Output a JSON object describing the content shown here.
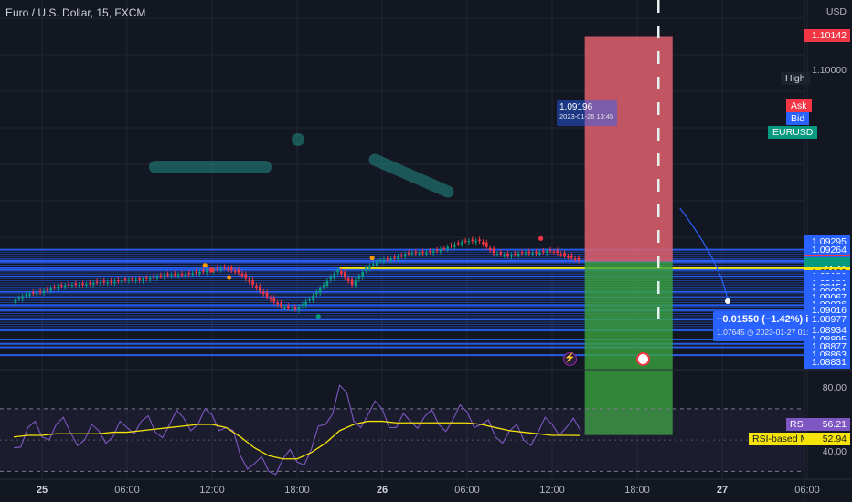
{
  "header": {
    "title": "Euro / U.S. Dollar, 15, FXCM"
  },
  "axis": {
    "currency": "USD"
  },
  "price_labels": [
    {
      "name": "price-label-stop",
      "text": "1.10142",
      "style": "red",
      "y": 1.10142
    },
    {
      "name": "price-tick-1-10000",
      "text": "1.10000",
      "style": "tick",
      "y": 1.1
    },
    {
      "name": "price-label-high",
      "text": "1.09295",
      "style": "blue",
      "y": 1.09295
    },
    {
      "name": "price-label-1-09264",
      "text": "1.09264",
      "style": "blue",
      "y": 1.09264
    },
    {
      "name": "price-label-ask",
      "text": "1.09219",
      "style": "red",
      "y": 1.09219
    },
    {
      "name": "price-label-bid",
      "text": "1.09215",
      "style": "blue",
      "y": 1.09215
    },
    {
      "name": "price-label-last",
      "text": "1.09215",
      "style": "green",
      "y": 1.09205
    },
    {
      "name": "price-label-change",
      "text": "+0.55%",
      "style": "green",
      "y": 1.09195
    },
    {
      "name": "price-label-countdown",
      "text": "11:11",
      "style": "green",
      "y": 1.09185
    },
    {
      "name": "price-label-yellow-level",
      "text": "1.09189",
      "style": "yellow",
      "y": 1.0917
    },
    {
      "name": "price-label-1-09181-a",
      "text": "1.09181",
      "style": "blue",
      "y": 1.09155
    },
    {
      "name": "price-label-1-09181-b",
      "text": "1.09181",
      "style": "blue",
      "y": 1.0914
    },
    {
      "name": "price-label-1-09181-c",
      "text": "1.09181",
      "style": "blue",
      "y": 1.09125
    },
    {
      "name": "price-label-1-09154",
      "text": "1.09154",
      "style": "blue",
      "y": 1.0911
    },
    {
      "name": "price-label-1-09091",
      "text": "1.09091",
      "style": "blue",
      "y": 1.0909
    },
    {
      "name": "price-label-1-09067",
      "text": "1.09067",
      "style": "blue",
      "y": 1.09067
    },
    {
      "name": "price-label-1-09036",
      "text": "1.09036",
      "style": "blue",
      "y": 1.09036
    },
    {
      "name": "price-label-1-09016",
      "text": "1.09016",
      "style": "blue",
      "y": 1.09016
    },
    {
      "name": "price-label-1-08977",
      "text": "1.08977",
      "style": "blue",
      "y": 1.08977
    },
    {
      "name": "price-label-1-08934",
      "text": "1.08934",
      "style": "blue",
      "y": 1.08934
    },
    {
      "name": "price-label-1-08895",
      "text": "1.08895",
      "style": "blue",
      "y": 1.08895
    },
    {
      "name": "price-label-1-08877",
      "text": "1.08877",
      "style": "blue",
      "y": 1.08865
    },
    {
      "name": "price-label-1-08863",
      "text": "1.08863",
      "style": "blue",
      "y": 1.0883
    },
    {
      "name": "price-label-1-08831",
      "text": "1.08831",
      "style": "blue",
      "y": 1.088
    }
  ],
  "side_tags": {
    "high": "High",
    "ask": "Ask",
    "bid": "Bid",
    "symbol": "EURUSD"
  },
  "tooltip": {
    "price": "1.09196",
    "date": "2023-01-26 13:45"
  },
  "measure": {
    "change": "−0.01550 (−1.42%) in",
    "target": "1.07645 ◷ 2023-01-27 01:"
  },
  "rsi_panel": {
    "ticks": [
      "80.00",
      "40.00"
    ],
    "rsi_label": "RSI",
    "rsi_value": "56.21",
    "ma_label": "RSI-based MA",
    "ma_value": "52.94"
  },
  "time_axis": [
    {
      "text": "25",
      "bold": true,
      "x": 0
    },
    {
      "text": "06:00",
      "bold": false,
      "x": 6
    },
    {
      "text": "12:00",
      "bold": false,
      "x": 12
    },
    {
      "text": "18:00",
      "bold": false,
      "x": 18
    },
    {
      "text": "26",
      "bold": true,
      "x": 24
    },
    {
      "text": "06:00",
      "bold": false,
      "x": 30
    },
    {
      "text": "12:00",
      "bold": false,
      "x": 36
    },
    {
      "text": "18:00",
      "bold": false,
      "x": 42
    },
    {
      "text": "27",
      "bold": true,
      "x": 48
    },
    {
      "text": "06:00",
      "bold": false,
      "x": 54
    }
  ],
  "colors": {
    "background": "#131722",
    "up": "#089981",
    "down": "#f23645",
    "level_line": "#2962ff",
    "yellow_level": "#f5e30a",
    "rsi_line": "#7e57c2",
    "rsi_ma": "#f5e30a",
    "stop_zone": "#e0626d",
    "target_zone": "#3ba33f"
  },
  "chart_data": {
    "type": "candlestick",
    "title": "Euro / U.S. Dollar, 15, FXCM",
    "xlabel": "",
    "ylabel": "USD",
    "x_unit": "hours from 2023-01-25 00:00",
    "ylim": [
      1.0879,
      1.1029
    ],
    "close_series": {
      "x": [
        -2,
        -1,
        0,
        1,
        2,
        3,
        4,
        5,
        6,
        7,
        8,
        9,
        10,
        11,
        12,
        13,
        14,
        15,
        16,
        17,
        18,
        19,
        20,
        21,
        22,
        23,
        24,
        25,
        26,
        27,
        28,
        29,
        30,
        31,
        32,
        33,
        34,
        35,
        36,
        37,
        38
      ],
      "y": [
        1.0905,
        1.0908,
        1.0909,
        1.0911,
        1.0912,
        1.0912,
        1.0913,
        1.0913,
        1.0914,
        1.0914,
        1.0915,
        1.0916,
        1.0916,
        1.0917,
        1.0918,
        1.0919,
        1.0917,
        1.0912,
        1.0907,
        1.0903,
        1.0902,
        1.0906,
        1.0912,
        1.0918,
        1.0912,
        1.0919,
        1.0922,
        1.0923,
        1.0925,
        1.0925,
        1.0926,
        1.0928,
        1.093,
        1.093,
        1.0925,
        1.0924,
        1.0925,
        1.0925,
        1.0926,
        1.0924,
        1.0922
      ]
    },
    "levels": [
      1.09264,
      1.09219,
      1.09215,
      1.09189,
      1.09181,
      1.09154,
      1.09091,
      1.09067,
      1.09036,
      1.09016,
      1.08977,
      1.08934,
      1.08895,
      1.08877,
      1.08863,
      1.08831
    ],
    "yellow_level": 1.09189,
    "position": {
      "type": "short",
      "entry": 1.09215,
      "stop": 1.10142,
      "target": 1.07645,
      "x_start": 38.3,
      "x_end": 44.5
    },
    "session_line_x": 43.5,
    "rsi": {
      "ylim": [
        25,
        95
      ],
      "bands": [
        70,
        30
      ],
      "x": [
        -2,
        -1,
        0,
        1,
        2,
        3,
        4,
        5,
        6,
        7,
        8,
        9,
        10,
        11,
        12,
        13,
        14,
        15,
        16,
        17,
        18,
        19,
        20,
        21,
        22,
        23,
        24,
        25,
        26,
        27,
        28,
        29,
        30,
        31,
        32,
        33,
        34,
        35,
        36,
        37,
        38
      ],
      "rsi": [
        45,
        58,
        52,
        60,
        55,
        50,
        56,
        52,
        58,
        62,
        55,
        60,
        64,
        60,
        66,
        58,
        40,
        35,
        30,
        38,
        36,
        44,
        60,
        85,
        62,
        66,
        70,
        58,
        62,
        65,
        60,
        63,
        68,
        60,
        52,
        56,
        50,
        55,
        60,
        58,
        56
      ],
      "ma": [
        52,
        53,
        53,
        54,
        54,
        54,
        54,
        55,
        55,
        56,
        57,
        58,
        59,
        60,
        60,
        58,
        52,
        45,
        40,
        38,
        38,
        42,
        48,
        56,
        60,
        62,
        62,
        61,
        61,
        61,
        61,
        61,
        61,
        60,
        58,
        56,
        55,
        54,
        53,
        53,
        52.94
      ]
    }
  }
}
